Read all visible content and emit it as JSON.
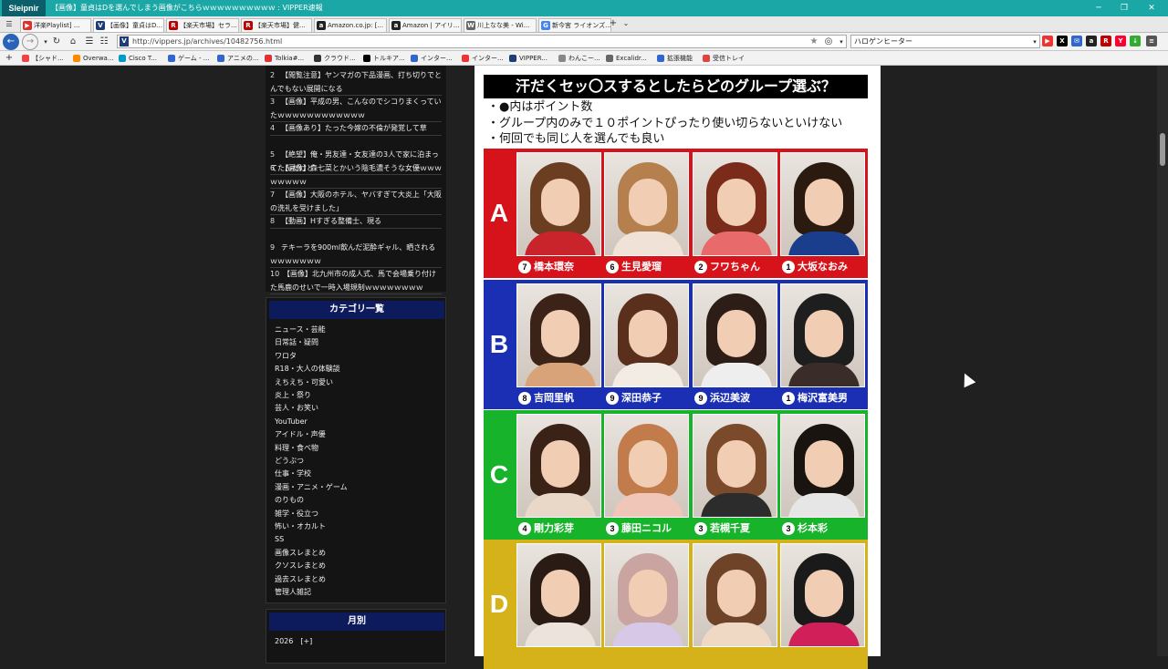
{
  "browser": {
    "logo": "Sleipnir",
    "title": "【画像】童貞はDを選んでしまう画像がこちらｗｗｗｗｗｗｗｗｗｗ : VIPPER速報",
    "tabs": [
      {
        "label": "洋楽Playlist] ...",
        "icon_color": "#e52d27",
        "icon": "▶"
      },
      {
        "label": "【画像】童貞はD...",
        "icon_color": "#1e3c7a",
        "icon": "V"
      },
      {
        "label": "【楽天市場】セラ...",
        "icon_color": "#bf0000",
        "icon": "R"
      },
      {
        "label": "【楽天市場】健...",
        "icon_color": "#bf0000",
        "icon": "R"
      },
      {
        "label": "Amazon.co.jp: [...",
        "icon_color": "#222",
        "icon": "a"
      },
      {
        "label": "Amazon | アイリ...",
        "icon_color": "#222",
        "icon": "a"
      },
      {
        "label": "川上なな美 - Wi...",
        "icon_color": "#666",
        "icon": "W"
      },
      {
        "label": "新今宮 ライオンズ...",
        "icon_color": "#4285f4",
        "icon": "G"
      }
    ],
    "url": "http://vippers.jp/archives/10482756.html",
    "search_value": "ハロゲンヒーター",
    "bookmarks": [
      {
        "label": "【シャド...",
        "color": "#e44"
      },
      {
        "label": "Overwa...",
        "color": "#f80"
      },
      {
        "label": "Cisco T...",
        "color": "#09c"
      },
      {
        "label": "ゲーム - ...",
        "color": "#36c"
      },
      {
        "label": "アニメの...",
        "color": "#36c"
      },
      {
        "label": "Tolkia#...",
        "color": "#d33"
      },
      {
        "label": "クラウド...",
        "color": "#333"
      },
      {
        "label": "トルキア...",
        "color": "#000"
      },
      {
        "label": "インター...",
        "color": "#36c"
      },
      {
        "label": "インター...",
        "color": "#e33"
      },
      {
        "label": "VIPPER...",
        "color": "#1e3c7a"
      },
      {
        "label": "わんこー...",
        "color": "#888"
      },
      {
        "label": "Excalidr...",
        "color": "#666"
      },
      {
        "label": "拡張機能",
        "color": "#36c"
      },
      {
        "label": "受信トレイ",
        "color": "#d44"
      }
    ]
  },
  "sidebar": {
    "ranking": [
      {
        "num": "2",
        "text": "【閲覧注意】ヤンマガの下品漫画、打ち切りでとんでもない展開になる"
      },
      {
        "num": "3",
        "text": "【画像】平成の男、こんなのでシコりまくっていたｗｗｗｗｗｗｗｗｗｗｗｗ"
      },
      {
        "num": "4",
        "text": "【画像あり】たった今嫁の不倫が発覚して草"
      },
      {
        "num": "5",
        "text": "【絶望】俺・男友達・女友達の3人で家に泊まってたんだけど"
      },
      {
        "num": "6",
        "text": "【画像】森七菜とかいう陰毛濃そうな女優ｗｗｗｗｗｗｗｗ"
      },
      {
        "num": "7",
        "text": "【画像】大阪のホテル、ヤバすぎて大炎上「大阪の洗礼を受けました」"
      },
      {
        "num": "8",
        "text": "【動画】Hすぎる整備士、現る"
      },
      {
        "num": "9",
        "text": "テキーラを900ml飲んだ泥酔ギャル、晒されるｗｗｗｗｗｗｗ"
      },
      {
        "num": "10",
        "text": "【画像】北九州市の成人式、馬で会場乗り付けた馬鹿のせいで一時入場規制ｗｗｗｗｗｗｗｗ"
      }
    ],
    "category_heading": "カテゴリ一覧",
    "categories": [
      "ニュース・芸能",
      "日常話・疑問",
      "ワロタ",
      "R18・大人の体験談",
      "えちえち・可愛い",
      "炎上・祭り",
      "芸人・お笑い",
      "YouTuber",
      "アイドル・声優",
      "料理・食べ物",
      "どうぶつ",
      "仕事・学校",
      "漫画・アニメ・ゲーム",
      "のりもの",
      "雑学・役立つ",
      "怖い・オカルト",
      "SS",
      "画像スレまとめ",
      "クソスレまとめ",
      "過去スレまとめ",
      "管理人雑記"
    ],
    "monthly_heading": "月別",
    "monthly_first": "2026　[+]"
  },
  "article": {
    "title": "汗だくセッ〇スするとしたらどのグループ選ぶ？",
    "rules": [
      "・●内はポイント数",
      "・グループ内のみで１０ポイントぴったり使い切らないといけない",
      "・何回でも同じ人を選んでも良い"
    ],
    "groups": [
      {
        "label": "A",
        "color": "#d6121a",
        "people": [
          {
            "pts": "7",
            "name": "橋本環奈",
            "hair": "#6b3e22",
            "body": "#c9232b"
          },
          {
            "pts": "6",
            "name": "生見愛瑠",
            "hair": "#b5804e",
            "body": "#f0e2d6"
          },
          {
            "pts": "2",
            "name": "フワちゃん",
            "hair": "#7b2b1a",
            "body": "#e86a6a"
          },
          {
            "pts": "1",
            "name": "大坂なおみ",
            "hair": "#2a1a10",
            "body": "#1a3d8c"
          }
        ]
      },
      {
        "label": "B",
        "color": "#1b2fb4",
        "people": [
          {
            "pts": "8",
            "name": "吉岡里帆",
            "hair": "#3b2318",
            "body": "#d9a37a"
          },
          {
            "pts": "9",
            "name": "深田恭子",
            "hair": "#5a2f1c",
            "body": "#f3ece4"
          },
          {
            "pts": "9",
            "name": "浜辺美波",
            "hair": "#2c1d16",
            "body": "#eeeeee"
          },
          {
            "pts": "1",
            "name": "梅沢富美男",
            "hair": "#1e1e1e",
            "body": "#3a2c28"
          }
        ]
      },
      {
        "label": "C",
        "color": "#17b32a",
        "people": [
          {
            "pts": "4",
            "name": "剛力彩芽",
            "hair": "#3a2216",
            "body": "#e9d7c7"
          },
          {
            "pts": "3",
            "name": "藤田ニコル",
            "hair": "#c27b4a",
            "body": "#efc6b8"
          },
          {
            "pts": "3",
            "name": "若槻千夏",
            "hair": "#7a4a2a",
            "body": "#2c2c2c"
          },
          {
            "pts": "3",
            "name": "杉本彩",
            "hair": "#1a1410",
            "body": "#e6e6e6"
          }
        ]
      },
      {
        "label": "D",
        "color": "#d6b21a",
        "people": [
          {
            "pts": "",
            "name": "",
            "hair": "#2a1c14",
            "body": "#ece4dc"
          },
          {
            "pts": "",
            "name": "",
            "hair": "#c9a4a0",
            "body": "#d8c8e8"
          },
          {
            "pts": "",
            "name": "",
            "hair": "#6e4328",
            "body": "#efd8c4"
          },
          {
            "pts": "",
            "name": "",
            "hair": "#1a1a1a",
            "body": "#d11f5a"
          }
        ]
      }
    ]
  }
}
